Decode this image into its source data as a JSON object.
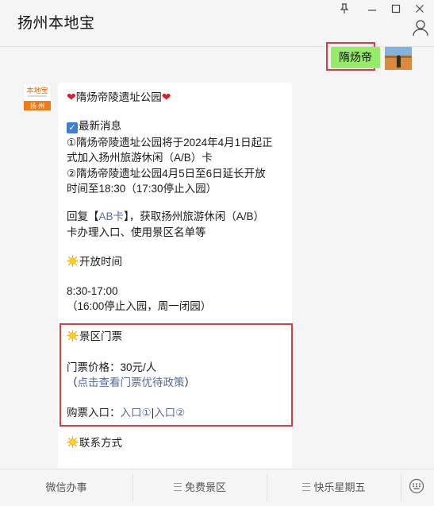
{
  "window": {
    "title": "扬州本地宝",
    "controls": [
      "pin-icon",
      "minimize-icon",
      "maximize-icon",
      "close-icon"
    ]
  },
  "my_message": {
    "text": "隋炀帝"
  },
  "bot": {
    "avatar_text_top": "本地宝",
    "avatar_text_bottom": "扬 州"
  },
  "article": {
    "title": "隋炀帝陵遗址公园",
    "news_heading": "最新消息",
    "news_1a": "①隋炀帝陵遗址公园将于2024年4月1日起正",
    "news_1b": "式加入扬州旅游休闲（A/B）卡",
    "news_2a": "②隋炀帝陵遗址公园4月5日至6日延长开放",
    "news_2b": "时间至18:30（17:30停止入园）",
    "reply_prefix": "回复【",
    "reply_keyword": "AB卡",
    "reply_suffix": "】，获取扬州旅游休闲（A/B）",
    "reply_line2": "卡办理入口、使用景区名单等",
    "open_heading": "开放时间",
    "open_hours": "8:30-17:00",
    "open_note": "（16:00停止入园，周一闭园）",
    "ticket_heading": "景区门票",
    "ticket_price": "门票价格：30元/人",
    "ticket_policy_open": "（",
    "ticket_policy_link": "点击查看门票优待政策",
    "ticket_policy_close": "）",
    "buy_label": "购票入口：",
    "buy_link1": "入口①",
    "buy_sep": "|",
    "buy_link2": "入口②",
    "contact_heading": "联系方式"
  },
  "menu": {
    "item1": "微信办事",
    "item2": "免费景区",
    "item3": "快乐星期五"
  },
  "colors": {
    "accent_green": "#95ec69",
    "link": "#576b95",
    "highlight_red": "#e0393e"
  }
}
